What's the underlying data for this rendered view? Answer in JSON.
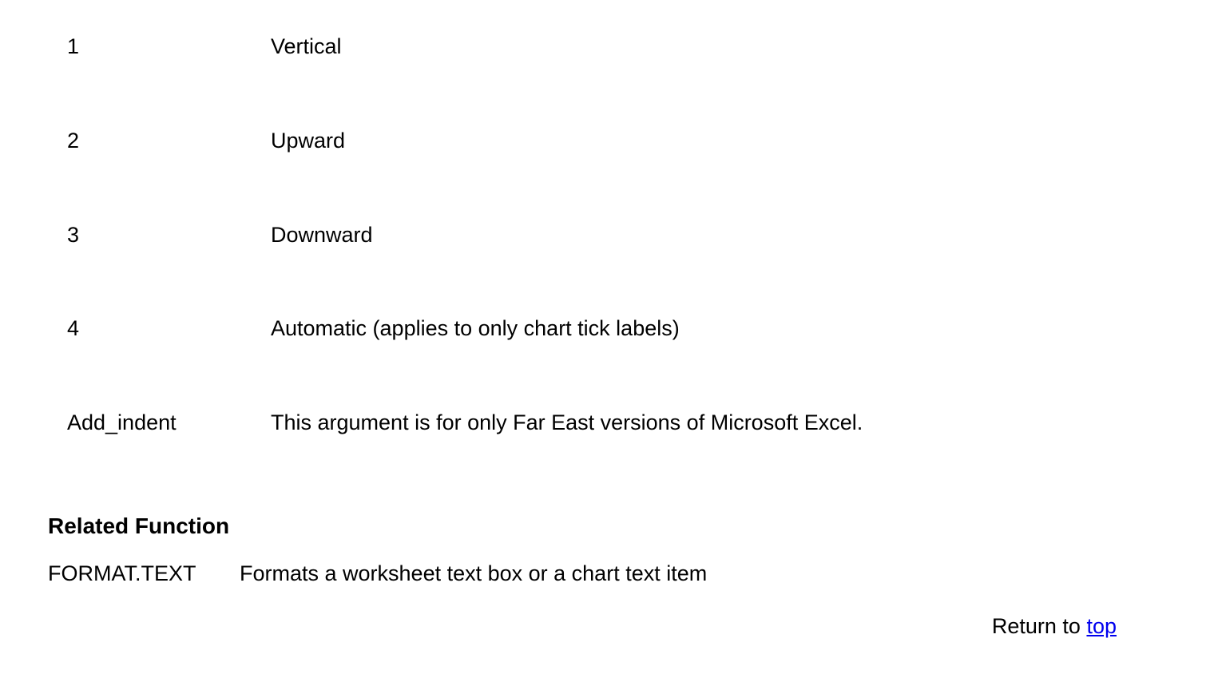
{
  "params": [
    {
      "key": "1",
      "value": "Vertical"
    },
    {
      "key": "2",
      "value": "Upward"
    },
    {
      "key": "3",
      "value": "Downward"
    },
    {
      "key": "4",
      "value": "Automatic (applies to only chart tick labels)"
    },
    {
      "key": "Add_indent",
      "value": "This argument is for only Far East versions of Microsoft Excel."
    }
  ],
  "related": {
    "heading": "Related Function",
    "name": "FORMAT.TEXT",
    "desc": "Formats a worksheet text box or a chart text item"
  },
  "returnTo": {
    "prefix": "Return to ",
    "linkText": "top"
  }
}
